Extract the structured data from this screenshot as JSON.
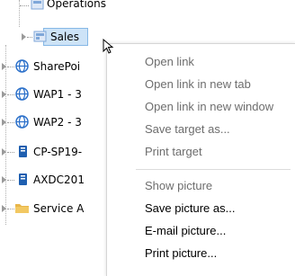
{
  "tree": {
    "items": [
      {
        "label": "Operations",
        "icon": "database-icon"
      },
      {
        "label": "Sales",
        "icon": "database-icon",
        "selected": true
      },
      {
        "label": "SharePoi",
        "icon": "globe-icon"
      },
      {
        "label": "WAP1 - 3",
        "icon": "globe-icon"
      },
      {
        "label": "WAP2 - 3",
        "icon": "globe-icon"
      },
      {
        "label": "CP-SP19-",
        "icon": "server-icon"
      },
      {
        "label": "AXDC201",
        "icon": "server-icon"
      },
      {
        "label": "Service A",
        "icon": "folder-icon"
      }
    ]
  },
  "context_menu": {
    "items": [
      {
        "label": "Open link",
        "enabled": false
      },
      {
        "label": "Open link in new tab",
        "enabled": false
      },
      {
        "label": "Open link in new window",
        "enabled": false
      },
      {
        "label": "Save target as...",
        "enabled": false
      },
      {
        "label": "Print target",
        "enabled": false
      },
      {
        "label": "Show picture",
        "enabled": false
      },
      {
        "label": "Save picture as...",
        "enabled": true
      },
      {
        "label": "E-mail picture...",
        "enabled": true
      },
      {
        "label": "Print picture...",
        "enabled": true
      }
    ]
  },
  "colors": {
    "selection_fill": "#cde3f7",
    "selection_border": "#86b8e6",
    "globe": "#2a6fc9",
    "server": "#1f5fb0",
    "folder": "#e8b64a",
    "database": "#7fa7d9",
    "disabled_text": "#6d6d6d"
  }
}
